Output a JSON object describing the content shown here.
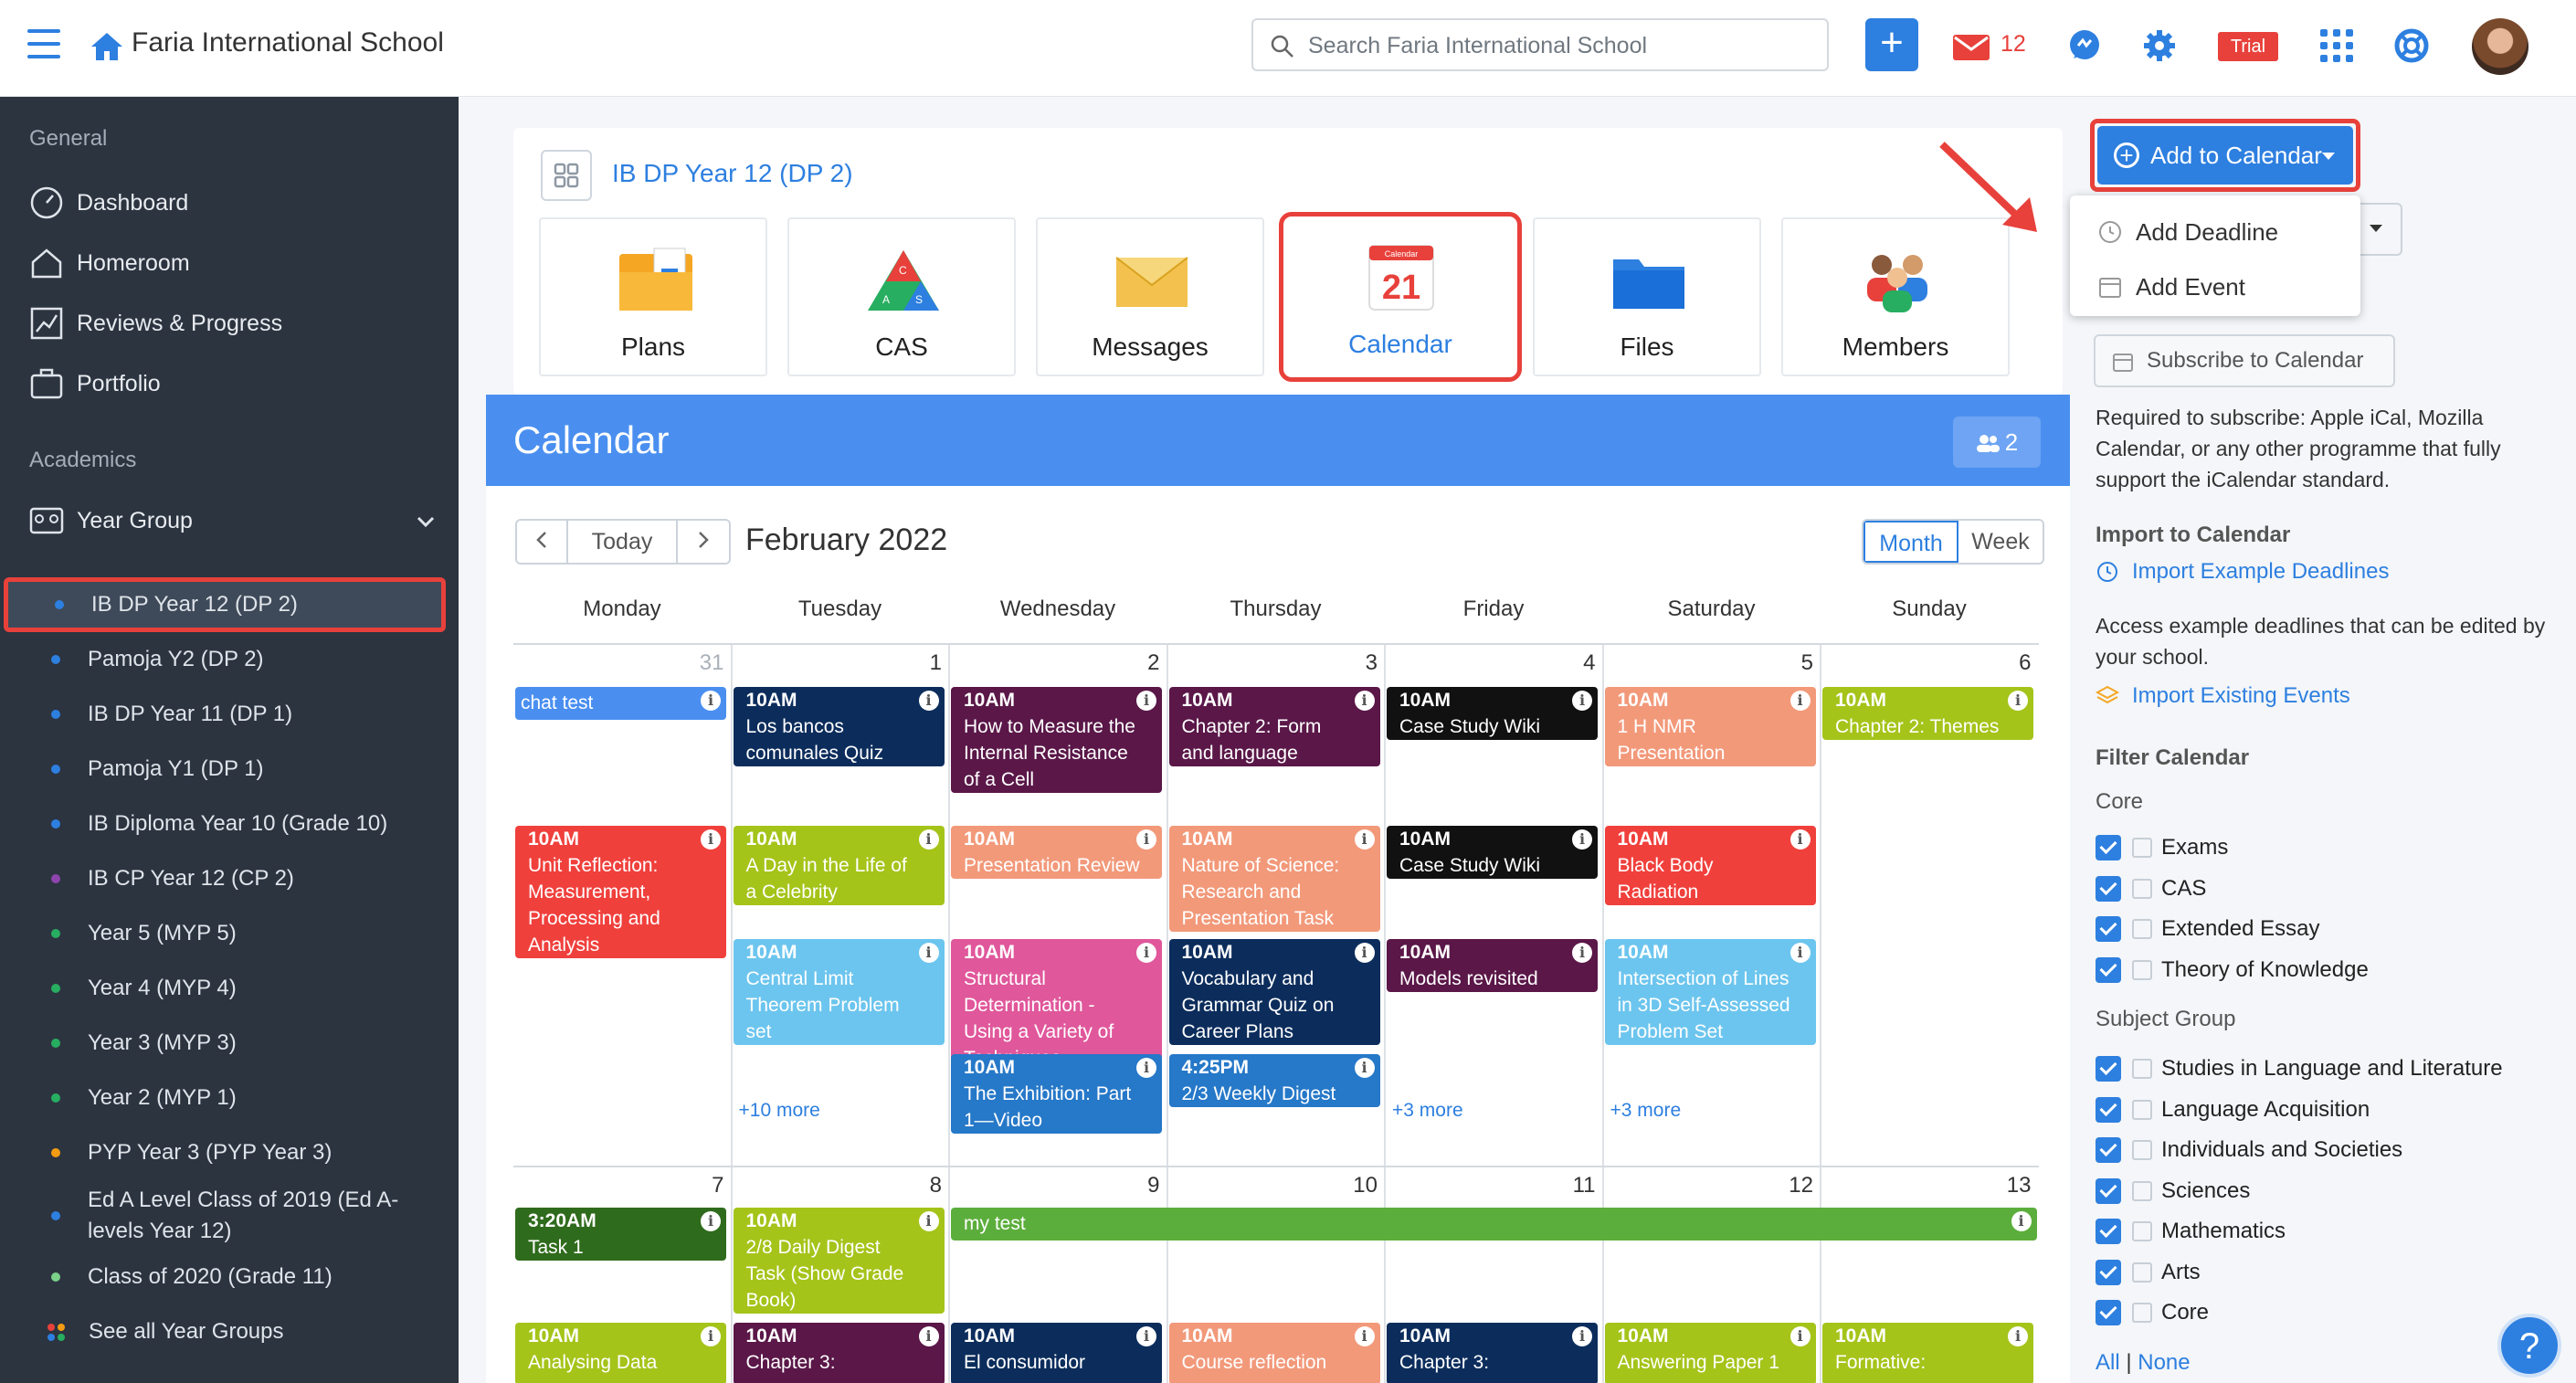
{
  "topbar": {
    "school_name": "Faria International School",
    "search_placeholder": "Search Faria International School",
    "mail_count": "12",
    "trial_badge": "Trial"
  },
  "sidebar": {
    "general_heading": "General",
    "general_items": [
      "Dashboard",
      "Homeroom",
      "Reviews & Progress",
      "Portfolio"
    ],
    "academics_heading": "Academics",
    "year_group_label": "Year Group",
    "year_groups": [
      {
        "label": "IB DP Year 12 (DP 2)",
        "dot": "#2d7fe0",
        "active": true
      },
      {
        "label": "Pamoja Y2 (DP 2)",
        "dot": "#2d7fe0"
      },
      {
        "label": "IB DP Year 11 (DP 1)",
        "dot": "#2d7fe0"
      },
      {
        "label": "Pamoja Y1 (DP 1)",
        "dot": "#2d7fe0"
      },
      {
        "label": "IB Diploma Year 10 (Grade 10)",
        "dot": "#2d7fe0"
      },
      {
        "label": "IB CP Year 12 (CP 2)",
        "dot": "#8e44ad"
      },
      {
        "label": "Year 5 (MYP 5)",
        "dot": "#27ae60"
      },
      {
        "label": "Year 4 (MYP 4)",
        "dot": "#27ae60"
      },
      {
        "label": "Year 3 (MYP 3)",
        "dot": "#27ae60"
      },
      {
        "label": "Year 2 (MYP 1)",
        "dot": "#27ae60"
      },
      {
        "label": "PYP Year 3 (PYP Year 3)",
        "dot": "#f39c12"
      },
      {
        "label": "Ed A Level Class of 2019 (Ed A-levels Year 12)",
        "dot": "#2d7fe0"
      },
      {
        "label": "Class of 2020 (Grade 11)",
        "dot": "#7bd08a"
      }
    ],
    "see_all": "See all Year Groups"
  },
  "group": {
    "title": "IB DP Year 12 (DP 2)",
    "tiles": [
      "Plans",
      "CAS",
      "Messages",
      "Calendar",
      "Files",
      "Members"
    ],
    "calendar_icon_day": "21",
    "calendar_icon_word": "Calendar"
  },
  "calendar": {
    "heading": "Calendar",
    "members_count": "2",
    "today_label": "Today",
    "month_title": "February 2022",
    "view_month": "Month",
    "view_week": "Week",
    "weekdays": [
      "Monday",
      "Tuesday",
      "Wednesday",
      "Thursday",
      "Friday",
      "Saturday",
      "Sunday"
    ],
    "week1_days": [
      "31",
      "1",
      "2",
      "3",
      "4",
      "5",
      "6"
    ],
    "week2_days": [
      "7",
      "8",
      "9",
      "10",
      "11",
      "12",
      "13"
    ],
    "info_glyph": "i",
    "week1_events": [
      {
        "time": "",
        "title": "chat test",
        "col": 0,
        "row": 0,
        "color": "#4a8ff0"
      },
      {
        "time": "10AM",
        "title": "Los bancos comunales Quiz",
        "col": 1,
        "row": 0,
        "color": "#0c2d5c"
      },
      {
        "time": "10AM",
        "title": "How to Measure the Internal Resistance of a Cell",
        "col": 2,
        "row": 0,
        "color": "#5a1748"
      },
      {
        "time": "10AM",
        "title": "Chapter 2: Form and language",
        "col": 3,
        "row": 0,
        "color": "#5a1748"
      },
      {
        "time": "10AM",
        "title": "Case Study Wiki",
        "col": 4,
        "row": 0,
        "color": "#111111"
      },
      {
        "time": "10AM",
        "title": "1 H NMR Presentation",
        "col": 5,
        "row": 0,
        "color": "#f2997a"
      },
      {
        "time": "10AM",
        "title": "Chapter 2: Themes",
        "col": 6,
        "row": 0,
        "color": "#a4c41a"
      },
      {
        "time": "10AM",
        "title": "Unit Reflection: Measurement, Processing and Analysis",
        "col": 0,
        "row": 1,
        "color": "#f0403c"
      },
      {
        "time": "10AM",
        "title": "A Day in the Life of a Celebrity",
        "col": 1,
        "row": 1,
        "color": "#a4c41a"
      },
      {
        "time": "10AM",
        "title": "Presentation Review",
        "col": 2,
        "row": 1,
        "color": "#f2997a"
      },
      {
        "time": "10AM",
        "title": "Nature of Science: Research and Presentation Task",
        "col": 3,
        "row": 1,
        "color": "#f2997a"
      },
      {
        "time": "10AM",
        "title": "Case Study Wiki",
        "col": 4,
        "row": 1,
        "color": "#111111"
      },
      {
        "time": "10AM",
        "title": "Black Body Radiation",
        "col": 5,
        "row": 1,
        "color": "#f0403c"
      },
      {
        "time": "10AM",
        "title": "Central Limit Theorem Problem set",
        "col": 1,
        "row": 2,
        "color": "#6cc5ee"
      },
      {
        "time": "10AM",
        "title": "Structural Determination - Using a Variety of Techniques",
        "col": 2,
        "row": 2,
        "color": "#e0579b"
      },
      {
        "time": "10AM",
        "title": "Vocabulary and Grammar Quiz on Career Plans",
        "col": 3,
        "row": 2,
        "color": "#0c2d5c"
      },
      {
        "time": "10AM",
        "title": "Models revisited",
        "col": 4,
        "row": 2,
        "color": "#5a1748"
      },
      {
        "time": "10AM",
        "title": "Intersection of Lines in 3D Self-Assessed Problem Set",
        "col": 5,
        "row": 2,
        "color": "#6cc5ee"
      },
      {
        "time": "10AM",
        "title": "The Exhibition: Part 1—Video",
        "col": 2,
        "row": 3,
        "color": "#2678c8"
      },
      {
        "time": "4:25PM",
        "title": "2/3 Weekly Digest",
        "col": 3,
        "row": 3,
        "color": "#2678c8"
      }
    ],
    "week1_more": [
      {
        "label": "+10 more",
        "col": 1
      },
      {
        "label": "+3 more",
        "col": 4
      },
      {
        "label": "+3 more",
        "col": 5
      }
    ],
    "week2_events": [
      {
        "time": "3:20AM",
        "title": "Task 1",
        "col": 0,
        "color": "#2f6b1c"
      },
      {
        "time": "10AM",
        "title": "2/8 Daily Digest Task (Show Grade Book)",
        "col": 1,
        "color": "#a4c41a"
      },
      {
        "time": "",
        "title": "my test",
        "col": 2,
        "color": "#5cae3c",
        "span": 5
      }
    ],
    "week2_bottom": [
      {
        "time": "10AM",
        "title": "Analysing Data",
        "col": 0,
        "color": "#a4c41a"
      },
      {
        "time": "10AM",
        "title": "Chapter 3:",
        "col": 1,
        "color": "#5a1748"
      },
      {
        "time": "10AM",
        "title": "El consumidor",
        "col": 2,
        "color": "#0c2d5c"
      },
      {
        "time": "10AM",
        "title": "Course reflection",
        "col": 3,
        "color": "#f2997a"
      },
      {
        "time": "10AM",
        "title": "Chapter 3:",
        "col": 4,
        "color": "#0c2d5c"
      },
      {
        "time": "10AM",
        "title": "Answering Paper 1",
        "col": 5,
        "color": "#a4c41a"
      },
      {
        "time": "10AM",
        "title": "Formative:",
        "col": 6,
        "color": "#a4c41a"
      }
    ]
  },
  "right": {
    "add_to_calendar": "Add to Calendar",
    "dropdown": [
      "Add Deadline",
      "Add Event"
    ],
    "subscribe": "Subscribe to Calendar",
    "subscribe_text": "Required to subscribe: Apple iCal, Mozilla Calendar, or any other programme that fully support the iCalendar standard.",
    "import_heading": "Import to Calendar",
    "import_example": "Import Example Deadlines",
    "import_text": "Access example deadlines that can be edited by your school.",
    "import_existing": "Import Existing Events",
    "filter_heading": "Filter Calendar",
    "core_heading": "Core",
    "core_items": [
      "Exams",
      "CAS",
      "Extended Essay",
      "Theory of Knowledge"
    ],
    "subject_heading": "Subject Group",
    "subject_items": [
      "Studies in Language and Literature",
      "Language Acquisition",
      "Individuals and Societies",
      "Sciences",
      "Mathematics",
      "Arts",
      "Core"
    ],
    "all_link": "All",
    "separator": "|",
    "none_link": "None"
  }
}
